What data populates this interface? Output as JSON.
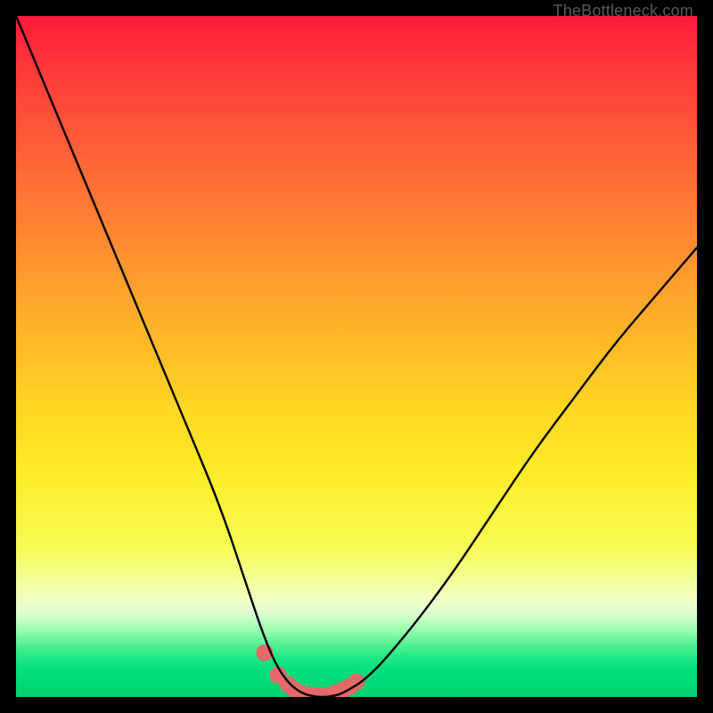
{
  "watermark": "TheBottleneck.com",
  "chart_data": {
    "type": "line",
    "title": "",
    "xlabel": "",
    "ylabel": "",
    "xlim": [
      0,
      100
    ],
    "ylim": [
      0,
      100
    ],
    "grid": false,
    "legend": false,
    "series": [
      {
        "name": "bottleneck-curve",
        "x": [
          0,
          5,
          10,
          15,
          20,
          25,
          30,
          34,
          36,
          38,
          40,
          42,
          44,
          46,
          48,
          52,
          58,
          64,
          70,
          76,
          82,
          88,
          94,
          100
        ],
        "y": [
          100,
          88,
          76,
          64,
          52,
          40,
          28,
          16,
          10,
          5,
          2,
          0.5,
          0,
          0,
          0.5,
          3,
          10,
          18,
          27,
          36,
          44,
          52,
          59,
          66
        ]
      }
    ],
    "markers": {
      "name": "highlight-dots",
      "color": "#e46a6a",
      "x": [
        36.5,
        38.5,
        40,
        41,
        42,
        43,
        44,
        45,
        46,
        47,
        48,
        49,
        50
      ],
      "y": [
        6.5,
        3.2,
        1.8,
        1.0,
        0.5,
        0.3,
        0.2,
        0.2,
        0.3,
        0.6,
        1.0,
        1.5,
        2.2
      ]
    },
    "gradient_stops": [
      {
        "pct": 0,
        "color": "#ff1a3c"
      },
      {
        "pct": 50,
        "color": "#ffd024"
      },
      {
        "pct": 80,
        "color": "#f6ff70"
      },
      {
        "pct": 100,
        "color": "#00d877"
      }
    ]
  }
}
